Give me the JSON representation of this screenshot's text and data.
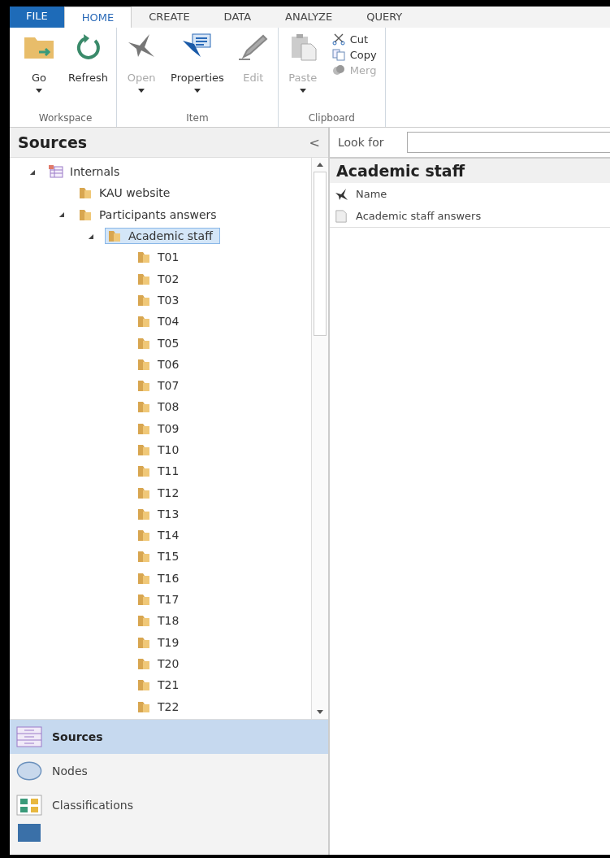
{
  "ribbon": {
    "tabs": [
      {
        "label": "FILE",
        "kind": "file",
        "selected": false
      },
      {
        "label": "HOME",
        "kind": "tab",
        "selected": true
      },
      {
        "label": "CREATE",
        "kind": "tab",
        "selected": false
      },
      {
        "label": "DATA",
        "kind": "tab",
        "selected": false
      },
      {
        "label": "ANALYZE",
        "kind": "tab",
        "selected": false
      },
      {
        "label": "QUERY",
        "kind": "tab",
        "selected": false
      }
    ],
    "groups": [
      {
        "label": "Workspace",
        "buttons": [
          {
            "label": "Go",
            "kind": "go",
            "dropdown": true,
            "disabled": false
          },
          {
            "label": "Refresh",
            "kind": "refresh",
            "dropdown": false,
            "disabled": false
          }
        ]
      },
      {
        "label": "Item",
        "buttons": [
          {
            "label": "Open",
            "kind": "open",
            "dropdown": true,
            "disabled": true
          },
          {
            "label": "Properties",
            "kind": "properties",
            "dropdown": true,
            "disabled": false
          },
          {
            "label": "Edit",
            "kind": "edit",
            "dropdown": false,
            "disabled": true
          }
        ]
      },
      {
        "label": "Clipboard",
        "buttons": [
          {
            "label": "Paste",
            "kind": "paste",
            "dropdown": true,
            "disabled": true
          }
        ],
        "small": [
          {
            "label": "Cut",
            "kind": "cut",
            "disabled": false
          },
          {
            "label": "Copy",
            "kind": "copy",
            "disabled": false
          },
          {
            "label": "Merg",
            "kind": "merge",
            "disabled": true
          }
        ]
      }
    ]
  },
  "sources": {
    "title": "Sources",
    "collapse": "<",
    "tree": [
      {
        "label": "Internals",
        "kind": "internals",
        "expanded": true,
        "selected": false,
        "children": [
          {
            "label": "KAU website",
            "kind": "folder",
            "selected": false
          },
          {
            "label": "Participants answers",
            "kind": "folder",
            "expanded": true,
            "selected": false,
            "children": [
              {
                "label": "Academic staff",
                "kind": "folder",
                "expanded": true,
                "selected": true,
                "children": [
                  {
                    "label": "T01",
                    "kind": "folder",
                    "selected": false
                  },
                  {
                    "label": "T02",
                    "kind": "folder",
                    "selected": false
                  },
                  {
                    "label": "T03",
                    "kind": "folder",
                    "selected": false
                  },
                  {
                    "label": "T04",
                    "kind": "folder",
                    "selected": false
                  },
                  {
                    "label": "T05",
                    "kind": "folder",
                    "selected": false
                  },
                  {
                    "label": "T06",
                    "kind": "folder",
                    "selected": false
                  },
                  {
                    "label": "T07",
                    "kind": "folder",
                    "selected": false
                  },
                  {
                    "label": "T08",
                    "kind": "folder",
                    "selected": false
                  },
                  {
                    "label": "T09",
                    "kind": "folder",
                    "selected": false
                  },
                  {
                    "label": "T10",
                    "kind": "folder",
                    "selected": false
                  },
                  {
                    "label": "T11",
                    "kind": "folder",
                    "selected": false
                  },
                  {
                    "label": "T12",
                    "kind": "folder",
                    "selected": false
                  },
                  {
                    "label": "T13",
                    "kind": "folder",
                    "selected": false
                  },
                  {
                    "label": "T14",
                    "kind": "folder",
                    "selected": false
                  },
                  {
                    "label": "T15",
                    "kind": "folder",
                    "selected": false
                  },
                  {
                    "label": "T16",
                    "kind": "folder",
                    "selected": false
                  },
                  {
                    "label": "T17",
                    "kind": "folder",
                    "selected": false
                  },
                  {
                    "label": "T18",
                    "kind": "folder",
                    "selected": false
                  },
                  {
                    "label": "T19",
                    "kind": "folder",
                    "selected": false
                  },
                  {
                    "label": "T20",
                    "kind": "folder",
                    "selected": false
                  },
                  {
                    "label": "T21",
                    "kind": "folder",
                    "selected": false
                  },
                  {
                    "label": "T22",
                    "kind": "folder",
                    "selected": false
                  }
                ]
              }
            ]
          }
        ]
      }
    ]
  },
  "navigation": [
    {
      "label": "Sources",
      "kind": "sources",
      "selected": true
    },
    {
      "label": "Nodes",
      "kind": "nodes",
      "selected": false
    },
    {
      "label": "Classifications",
      "kind": "classifications",
      "selected": false
    },
    {
      "kind": "collections",
      "selected": false
    }
  ],
  "detail": {
    "search": {
      "label": "Look for"
    },
    "title": "Academic staff",
    "columns": [
      "Name"
    ],
    "rows": [
      {
        "name": "Academic staff answers"
      }
    ]
  }
}
